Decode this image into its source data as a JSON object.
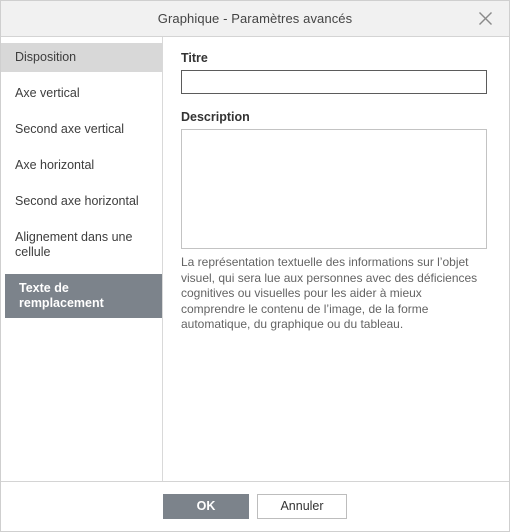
{
  "window": {
    "title": "Graphique - Paramètres avancés",
    "close_icon": "close-icon"
  },
  "sidebar": {
    "items": [
      {
        "label": "Disposition",
        "state": "hover"
      },
      {
        "label": "Axe vertical",
        "state": "normal"
      },
      {
        "label": "Second axe vertical",
        "state": "normal"
      },
      {
        "label": "Axe horizontal",
        "state": "normal"
      },
      {
        "label": "Second axe horizontal",
        "state": "normal"
      },
      {
        "label": "Alignement dans une cellule",
        "state": "normal"
      },
      {
        "label": "Texte de remplacement",
        "state": "selected"
      }
    ]
  },
  "content": {
    "title_label": "Titre",
    "title_value": "",
    "title_placeholder": "",
    "description_label": "Description",
    "description_value": "",
    "description_placeholder": "",
    "help_text": "La représentation textuelle des informations sur l’objet visuel, qui sera lue aux personnes avec des déficiences cognitives ou visuelles pour les aider à mieux comprendre le contenu de l’image, de la forme automatique, du graphique ou du tableau."
  },
  "footer": {
    "ok_label": "OK",
    "cancel_label": "Annuler"
  },
  "colors": {
    "titlebar_bg": "#f1f1f1",
    "selected_bg": "#7c838b",
    "hover_bg": "#d8d8d8",
    "primary_button_bg": "#7c838b",
    "border": "#d4d4d4"
  }
}
